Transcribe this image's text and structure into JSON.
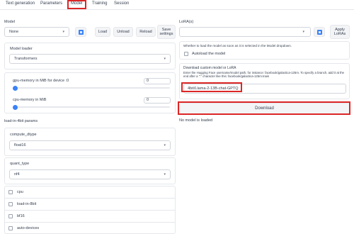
{
  "tabs": [
    {
      "label": "Text generation"
    },
    {
      "label": "Parameters"
    },
    {
      "label": "Model"
    },
    {
      "label": "Training"
    },
    {
      "label": "Session"
    }
  ],
  "model": {
    "label": "Model",
    "selected": "None",
    "load": "Load",
    "unload": "Unload",
    "reload": "Reload",
    "save_settings": "Save settings"
  },
  "loader": {
    "label": "Model loader",
    "selected": "Transformers"
  },
  "gpu_memory": {
    "label": "gpu-memory in MiB for device :0",
    "value": "0",
    "level": 0
  },
  "cpu_memory": {
    "label": "cpu-memory in MiB",
    "value": "0",
    "level": 0
  },
  "load4bit": {
    "label": "load-in-4bit params",
    "compute_dtype_label": "compute_dtype",
    "compute_dtype_value": "float16",
    "quant_type_label": "quant_type",
    "quant_type_value": "nf4"
  },
  "checkboxes": [
    {
      "label": "cpu",
      "checked": false
    },
    {
      "label": "load-in-8bit",
      "checked": false
    },
    {
      "label": "bf16",
      "checked": false
    },
    {
      "label": "auto-devices",
      "checked": false
    }
  ],
  "lora": {
    "label": "LoRA(s)",
    "selected": "",
    "apply": "Apply LoRAs"
  },
  "autoload": {
    "hint": "Whether to load the model as soon as it is selected in the Model dropdown.",
    "label": "Autoload the model",
    "checked": false
  },
  "download": {
    "title": "Download custom model or LoRA",
    "description": "Enter the Hugging Face username/model path, for instance: facebook/galactica-125m. To specify a branch, add it at the end after a \":\" character like this: facebook/galactica-125m:main",
    "value": "4bit/Llama-2-13B-chat-GPTQ",
    "button": "Download"
  },
  "status": "No model is loaded",
  "colors": {
    "accent": "#3b82f6",
    "highlight": "#dc2626"
  }
}
